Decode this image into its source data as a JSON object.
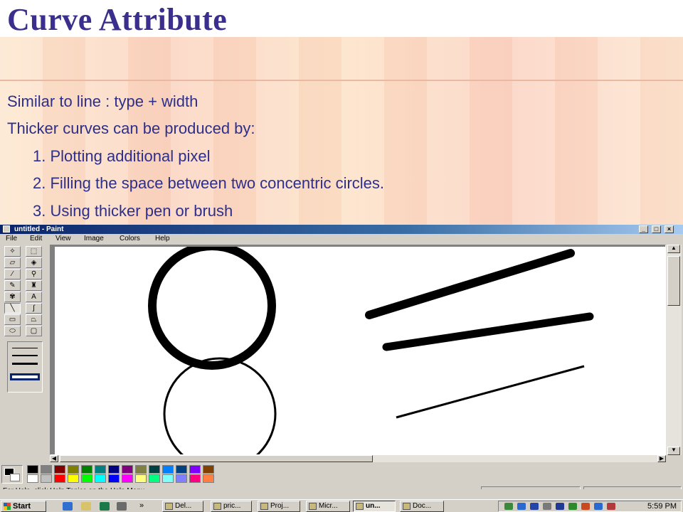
{
  "slide": {
    "title": "Curve Attribute",
    "bullets": [
      "Similar to line : type + width",
      "Thicker curves can be produced by:",
      "1. Plotting additional pixel",
      "2. Filling the space between two concentric circles.",
      "3. Using thicker pen or brush"
    ]
  },
  "paint": {
    "window_title": "untitled - Paint",
    "menu": [
      "File",
      "Edit",
      "View",
      "Image",
      "Colors",
      "Help"
    ],
    "window_buttons": [
      "_",
      "□",
      "×"
    ],
    "tools": [
      "free-select",
      "rect-select",
      "eraser",
      "fill-bucket",
      "color-picker",
      "magnifier",
      "pencil",
      "brush",
      "airbrush",
      "text",
      "line",
      "curve",
      "rectangle",
      "polygon",
      "ellipse",
      "rounded-rectangle"
    ],
    "selected_tool": "line",
    "palette_colors": [
      "#000000",
      "#808080",
      "#800000",
      "#808000",
      "#008000",
      "#008080",
      "#000080",
      "#800080",
      "#808040",
      "#004040",
      "#0080ff",
      "#004080",
      "#8000ff",
      "#804000",
      "#ffffff",
      "#c0c0c0",
      "#ff0000",
      "#ffff00",
      "#00ff00",
      "#00ffff",
      "#0000ff",
      "#ff00ff",
      "#ffff80",
      "#00ff80",
      "#80ffff",
      "#8080ff",
      "#ff0080",
      "#ff8040"
    ],
    "foreground_color": "#000000",
    "background_color": "#ffffff",
    "status_text": "For Help, click Help Topics on the Help Menu."
  },
  "taskbar": {
    "start_label": "Start",
    "tasks": [
      {
        "label": "Del...",
        "active": false
      },
      {
        "label": "pric...",
        "active": false
      },
      {
        "label": "Proj...",
        "active": false
      },
      {
        "label": "Micr...",
        "active": false
      },
      {
        "label": "un...",
        "active": true
      },
      {
        "label": "Doc...",
        "active": false
      }
    ],
    "chevron": "»",
    "clock": "5:59 PM"
  }
}
